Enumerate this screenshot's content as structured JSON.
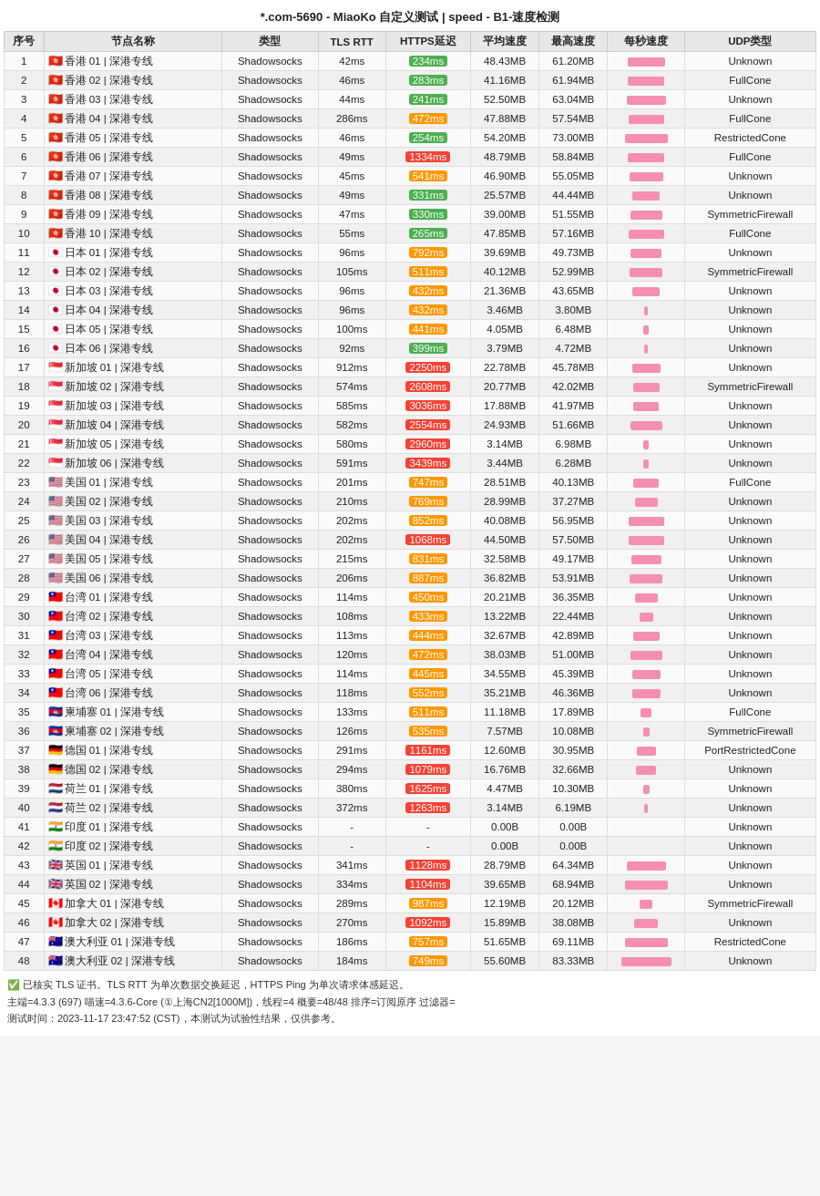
{
  "title": "*.com-5690 - MiaoKo 自定义测试 | speed - B1-速度检测",
  "columns": [
    "序号",
    "节点名称",
    "类型",
    "TLS RTT",
    "HTTPS延迟",
    "平均速度",
    "最高速度",
    "每秒速度",
    "UDP类型"
  ],
  "rows": [
    {
      "id": 1,
      "flag": "🇭🇰",
      "name": "香港 01 | 深港专线",
      "type": "Shadowsocks",
      "tls": "42ms",
      "https": "234ms",
      "https_class": "green",
      "avg": "48.43MB",
      "max": "61.20MB",
      "bar": 75,
      "udp": "Unknown"
    },
    {
      "id": 2,
      "flag": "🇭🇰",
      "name": "香港 02 | 深港专线",
      "type": "Shadowsocks",
      "tls": "46ms",
      "https": "283ms",
      "https_class": "green",
      "avg": "41.16MB",
      "max": "61.94MB",
      "bar": 72,
      "udp": "FullCone"
    },
    {
      "id": 3,
      "flag": "🇭🇰",
      "name": "香港 03 | 深港专线",
      "type": "Shadowsocks",
      "tls": "44ms",
      "https": "241ms",
      "https_class": "green",
      "avg": "52.50MB",
      "max": "63.04MB",
      "bar": 78,
      "udp": "Unknown"
    },
    {
      "id": 4,
      "flag": "🇭🇰",
      "name": "香港 04 | 深港专线",
      "type": "Shadowsocks",
      "tls": "286ms",
      "https": "472ms",
      "https_class": "orange",
      "avg": "47.88MB",
      "max": "57.54MB",
      "bar": 70,
      "udp": "FullCone"
    },
    {
      "id": 5,
      "flag": "🇭🇰",
      "name": "香港 05 | 深港专线",
      "type": "Shadowsocks",
      "tls": "46ms",
      "https": "254ms",
      "https_class": "green",
      "avg": "54.20MB",
      "max": "73.00MB",
      "bar": 85,
      "udp": "RestrictedCone"
    },
    {
      "id": 6,
      "flag": "🇭🇰",
      "name": "香港 06 | 深港专线",
      "type": "Shadowsocks",
      "tls": "49ms",
      "https": "1334ms",
      "https_class": "red",
      "avg": "48.79MB",
      "max": "58.84MB",
      "bar": 72,
      "udp": "FullCone"
    },
    {
      "id": 7,
      "flag": "🇭🇰",
      "name": "香港 07 | 深港专线",
      "type": "Shadowsocks",
      "tls": "45ms",
      "https": "541ms",
      "https_class": "orange",
      "avg": "46.90MB",
      "max": "55.05MB",
      "bar": 68,
      "udp": "Unknown"
    },
    {
      "id": 8,
      "flag": "🇭🇰",
      "name": "香港 08 | 深港专线",
      "type": "Shadowsocks",
      "tls": "49ms",
      "https": "331ms",
      "https_class": "green",
      "avg": "25.57MB",
      "max": "44.44MB",
      "bar": 55,
      "udp": "Unknown"
    },
    {
      "id": 9,
      "flag": "🇭🇰",
      "name": "香港 09 | 深港专线",
      "type": "Shadowsocks",
      "tls": "47ms",
      "https": "330ms",
      "https_class": "green",
      "avg": "39.00MB",
      "max": "51.55MB",
      "bar": 63,
      "udp": "SymmetricFirewall"
    },
    {
      "id": 10,
      "flag": "🇭🇰",
      "name": "香港 10 | 深港专线",
      "type": "Shadowsocks",
      "tls": "55ms",
      "https": "265ms",
      "https_class": "green",
      "avg": "47.85MB",
      "max": "57.16MB",
      "bar": 70,
      "udp": "FullCone"
    },
    {
      "id": 11,
      "flag": "🇯🇵",
      "name": "日本 01 | 深港专线",
      "type": "Shadowsocks",
      "tls": "96ms",
      "https": "792ms",
      "https_class": "orange",
      "avg": "39.69MB",
      "max": "49.73MB",
      "bar": 61,
      "udp": "Unknown"
    },
    {
      "id": 12,
      "flag": "🇯🇵",
      "name": "日本 02 | 深港专线",
      "type": "Shadowsocks",
      "tls": "105ms",
      "https": "511ms",
      "https_class": "orange",
      "avg": "40.12MB",
      "max": "52.99MB",
      "bar": 65,
      "udp": "SymmetricFirewall"
    },
    {
      "id": 13,
      "flag": "🇯🇵",
      "name": "日本 03 | 深港专线",
      "type": "Shadowsocks",
      "tls": "96ms",
      "https": "432ms",
      "https_class": "orange",
      "avg": "21.36MB",
      "max": "43.65MB",
      "bar": 54,
      "udp": "Unknown"
    },
    {
      "id": 14,
      "flag": "🇯🇵",
      "name": "日本 04 | 深港专线",
      "type": "Shadowsocks",
      "tls": "96ms",
      "https": "432ms",
      "https_class": "orange",
      "avg": "3.46MB",
      "max": "3.80MB",
      "bar": 8,
      "udp": "Unknown"
    },
    {
      "id": 15,
      "flag": "🇯🇵",
      "name": "日本 05 | 深港专线",
      "type": "Shadowsocks",
      "tls": "100ms",
      "https": "441ms",
      "https_class": "orange",
      "avg": "4.05MB",
      "max": "6.48MB",
      "bar": 10,
      "udp": "Unknown"
    },
    {
      "id": 16,
      "flag": "🇯🇵",
      "name": "日本 06 | 深港专线",
      "type": "Shadowsocks",
      "tls": "92ms",
      "https": "399ms",
      "https_class": "green",
      "avg": "3.79MB",
      "max": "4.72MB",
      "bar": 8,
      "udp": "Unknown"
    },
    {
      "id": 17,
      "flag": "🇸🇬",
      "name": "新加坡 01 | 深港专线",
      "type": "Shadowsocks",
      "tls": "912ms",
      "https": "2250ms",
      "https_class": "red",
      "avg": "22.78MB",
      "max": "45.78MB",
      "bar": 56,
      "udp": "Unknown"
    },
    {
      "id": 18,
      "flag": "🇸🇬",
      "name": "新加坡 02 | 深港专线",
      "type": "Shadowsocks",
      "tls": "574ms",
      "https": "2608ms",
      "https_class": "red",
      "avg": "20.77MB",
      "max": "42.02MB",
      "bar": 52,
      "udp": "SymmetricFirewall"
    },
    {
      "id": 19,
      "flag": "🇸🇬",
      "name": "新加坡 03 | 深港专线",
      "type": "Shadowsocks",
      "tls": "585ms",
      "https": "3036ms",
      "https_class": "red",
      "avg": "17.88MB",
      "max": "41.97MB",
      "bar": 51,
      "udp": "Unknown"
    },
    {
      "id": 20,
      "flag": "🇸🇬",
      "name": "新加坡 04 | 深港专线",
      "type": "Shadowsocks",
      "tls": "582ms",
      "https": "2554ms",
      "https_class": "red",
      "avg": "24.93MB",
      "max": "51.66MB",
      "bar": 63,
      "udp": "Unknown"
    },
    {
      "id": 21,
      "flag": "🇸🇬",
      "name": "新加坡 05 | 深港专线",
      "type": "Shadowsocks",
      "tls": "580ms",
      "https": "2960ms",
      "https_class": "red",
      "avg": "3.14MB",
      "max": "6.98MB",
      "bar": 10,
      "udp": "Unknown"
    },
    {
      "id": 22,
      "flag": "🇸🇬",
      "name": "新加坡 06 | 深港专线",
      "type": "Shadowsocks",
      "tls": "591ms",
      "https": "3439ms",
      "https_class": "red",
      "avg": "3.44MB",
      "max": "6.28MB",
      "bar": 10,
      "udp": "Unknown"
    },
    {
      "id": 23,
      "flag": "🇺🇸",
      "name": "美国 01 | 深港专线",
      "type": "Shadowsocks",
      "tls": "201ms",
      "https": "747ms",
      "https_class": "orange",
      "avg": "28.51MB",
      "max": "40.13MB",
      "bar": 50,
      "udp": "FullCone"
    },
    {
      "id": 24,
      "flag": "🇺🇸",
      "name": "美国 02 | 深港专线",
      "type": "Shadowsocks",
      "tls": "210ms",
      "https": "769ms",
      "https_class": "orange",
      "avg": "28.99MB",
      "max": "37.27MB",
      "bar": 46,
      "udp": "Unknown"
    },
    {
      "id": 25,
      "flag": "🇺🇸",
      "name": "美国 03 | 深港专线",
      "type": "Shadowsocks",
      "tls": "202ms",
      "https": "852ms",
      "https_class": "orange",
      "avg": "40.08MB",
      "max": "56.95MB",
      "bar": 70,
      "udp": "Unknown"
    },
    {
      "id": 26,
      "flag": "🇺🇸",
      "name": "美国 04 | 深港专线",
      "type": "Shadowsocks",
      "tls": "202ms",
      "https": "1068ms",
      "https_class": "red",
      "avg": "44.50MB",
      "max": "57.50MB",
      "bar": 71,
      "udp": "Unknown"
    },
    {
      "id": 27,
      "flag": "🇺🇸",
      "name": "美国 05 | 深港专线",
      "type": "Shadowsocks",
      "tls": "215ms",
      "https": "831ms",
      "https_class": "orange",
      "avg": "32.58MB",
      "max": "49.17MB",
      "bar": 60,
      "udp": "Unknown"
    },
    {
      "id": 28,
      "flag": "🇺🇸",
      "name": "美国 06 | 深港专线",
      "type": "Shadowsocks",
      "tls": "206ms",
      "https": "887ms",
      "https_class": "orange",
      "avg": "36.82MB",
      "max": "53.91MB",
      "bar": 66,
      "udp": "Unknown"
    },
    {
      "id": 29,
      "flag": "🇹🇼",
      "name": "台湾 01 | 深港专线",
      "type": "Shadowsocks",
      "tls": "114ms",
      "https": "450ms",
      "https_class": "orange",
      "avg": "20.21MB",
      "max": "36.35MB",
      "bar": 45,
      "udp": "Unknown"
    },
    {
      "id": 30,
      "flag": "🇹🇼",
      "name": "台湾 02 | 深港专线",
      "type": "Shadowsocks",
      "tls": "108ms",
      "https": "433ms",
      "https_class": "orange",
      "avg": "13.22MB",
      "max": "22.44MB",
      "bar": 28,
      "udp": "Unknown"
    },
    {
      "id": 31,
      "flag": "🇹🇼",
      "name": "台湾 03 | 深港专线",
      "type": "Shadowsocks",
      "tls": "113ms",
      "https": "444ms",
      "https_class": "orange",
      "avg": "32.67MB",
      "max": "42.89MB",
      "bar": 52,
      "udp": "Unknown"
    },
    {
      "id": 32,
      "flag": "🇹🇼",
      "name": "台湾 04 | 深港专线",
      "type": "Shadowsocks",
      "tls": "120ms",
      "https": "472ms",
      "https_class": "orange",
      "avg": "38.03MB",
      "max": "51.00MB",
      "bar": 63,
      "udp": "Unknown"
    },
    {
      "id": 33,
      "flag": "🇹🇼",
      "name": "台湾 05 | 深港专线",
      "type": "Shadowsocks",
      "tls": "114ms",
      "https": "445ms",
      "https_class": "orange",
      "avg": "34.55MB",
      "max": "45.39MB",
      "bar": 56,
      "udp": "Unknown"
    },
    {
      "id": 34,
      "flag": "🇹🇼",
      "name": "台湾 06 | 深港专线",
      "type": "Shadowsocks",
      "tls": "118ms",
      "https": "552ms",
      "https_class": "orange",
      "avg": "35.21MB",
      "max": "46.36MB",
      "bar": 57,
      "udp": "Unknown"
    },
    {
      "id": 35,
      "flag": "🇰🇭",
      "name": "柬埔寨 01 | 深港专线",
      "type": "Shadowsocks",
      "tls": "133ms",
      "https": "511ms",
      "https_class": "orange",
      "avg": "11.18MB",
      "max": "17.89MB",
      "bar": 22,
      "udp": "FullCone"
    },
    {
      "id": 36,
      "flag": "🇰🇭",
      "name": "柬埔寨 02 | 深港专线",
      "type": "Shadowsocks",
      "tls": "126ms",
      "https": "535ms",
      "https_class": "orange",
      "avg": "7.57MB",
      "max": "10.08MB",
      "bar": 13,
      "udp": "SymmetricFirewall"
    },
    {
      "id": 37,
      "flag": "🇩🇪",
      "name": "德国 01 | 深港专线",
      "type": "Shadowsocks",
      "tls": "291ms",
      "https": "1161ms",
      "https_class": "red",
      "avg": "12.60MB",
      "max": "30.95MB",
      "bar": 38,
      "udp": "PortRestrictedCone"
    },
    {
      "id": 38,
      "flag": "🇩🇪",
      "name": "德国 02 | 深港专线",
      "type": "Shadowsocks",
      "tls": "294ms",
      "https": "1079ms",
      "https_class": "red",
      "avg": "16.76MB",
      "max": "32.66MB",
      "bar": 40,
      "udp": "Unknown"
    },
    {
      "id": 39,
      "flag": "🇳🇱",
      "name": "荷兰 01 | 深港专线",
      "type": "Shadowsocks",
      "tls": "380ms",
      "https": "1625ms",
      "https_class": "red",
      "avg": "4.47MB",
      "max": "10.30MB",
      "bar": 13,
      "udp": "Unknown"
    },
    {
      "id": 40,
      "flag": "🇳🇱",
      "name": "荷兰 02 | 深港专线",
      "type": "Shadowsocks",
      "tls": "372ms",
      "https": "1263ms",
      "https_class": "red",
      "avg": "3.14MB",
      "max": "6.19MB",
      "bar": 8,
      "udp": "Unknown"
    },
    {
      "id": 41,
      "flag": "🇮🇳",
      "name": "印度 01 | 深港专线",
      "type": "Shadowsocks",
      "tls": "-",
      "https": "-",
      "https_class": "none",
      "avg": "0.00B",
      "max": "0.00B",
      "bar": 0,
      "udp": "Unknown"
    },
    {
      "id": 42,
      "flag": "🇮🇳",
      "name": "印度 02 | 深港专线",
      "type": "Shadowsocks",
      "tls": "-",
      "https": "-",
      "https_class": "none",
      "avg": "0.00B",
      "max": "0.00B",
      "bar": 0,
      "udp": "Unknown"
    },
    {
      "id": 43,
      "flag": "🇬🇧",
      "name": "英国 01 | 深港专线",
      "type": "Shadowsocks",
      "tls": "341ms",
      "https": "1128ms",
      "https_class": "red",
      "avg": "28.79MB",
      "max": "64.34MB",
      "bar": 79,
      "udp": "Unknown"
    },
    {
      "id": 44,
      "flag": "🇬🇧",
      "name": "英国 02 | 深港专线",
      "type": "Shadowsocks",
      "tls": "334ms",
      "https": "1104ms",
      "https_class": "red",
      "avg": "39.65MB",
      "max": "68.94MB",
      "bar": 85,
      "udp": "Unknown"
    },
    {
      "id": 45,
      "flag": "🇨🇦",
      "name": "加拿大 01 | 深港专线",
      "type": "Shadowsocks",
      "tls": "289ms",
      "https": "987ms",
      "https_class": "orange",
      "avg": "12.19MB",
      "max": "20.12MB",
      "bar": 25,
      "udp": "SymmetricFirewall"
    },
    {
      "id": 46,
      "flag": "🇨🇦",
      "name": "加拿大 02 | 深港专线",
      "type": "Shadowsocks",
      "tls": "270ms",
      "https": "1092ms",
      "https_class": "red",
      "avg": "15.89MB",
      "max": "38.08MB",
      "bar": 47,
      "udp": "Unknown"
    },
    {
      "id": 47,
      "flag": "🇦🇺",
      "name": "澳大利亚 01 | 深港专线",
      "type": "Shadowsocks",
      "tls": "186ms",
      "https": "757ms",
      "https_class": "orange",
      "avg": "51.65MB",
      "max": "69.11MB",
      "bar": 85,
      "udp": "RestrictedCone"
    },
    {
      "id": 48,
      "flag": "🇦🇺",
      "name": "澳大利亚 02 | 深港专线",
      "type": "Shadowsocks",
      "tls": "184ms",
      "https": "749ms",
      "https_class": "orange",
      "avg": "55.60MB",
      "max": "83.33MB",
      "bar": 100,
      "udp": "Unknown"
    }
  ],
  "footer": {
    "line1": "✅ 已核实 TLS 证书。TLS RTT 为单次数据交换延迟，HTTPS Ping 为单次请求体感延迟。",
    "line2": "主端=4.3.3 (697) 喵速=4.3.6-Core (①上海CN2[1000M])，线程=4 概要=48/48 排序=订阅原序 过滤器=",
    "line3": "测试时间：2023-11-17 23:47:52 (CST)，本测试为试验性结果，仅供参考。"
  }
}
